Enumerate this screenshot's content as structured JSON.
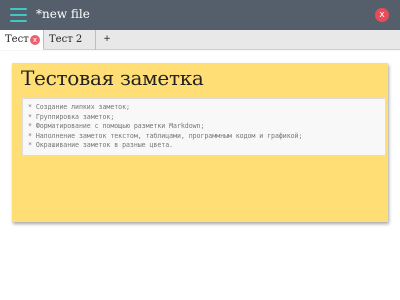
{
  "window": {
    "title": "*new file",
    "close_label": "x"
  },
  "tabs": [
    {
      "label": "Тест",
      "active": true,
      "close_label": "x"
    },
    {
      "label": "Тест 2",
      "active": false
    }
  ],
  "tab_add_label": "+",
  "note": {
    "title": "Тестовая заметка",
    "color": "#ffde75",
    "lines": [
      "* Создание липких заметок;",
      "* Группировка заметок;",
      "* Форматирование с помощью разметки Markdown;",
      "* Наполнение заметок текстом, таблицами, программным кодом и графикой;",
      "* Окрашивание заметок в разные цвета."
    ]
  },
  "colors": {
    "titlebar": "#555f6b",
    "accent": "#3fc7c7",
    "close": "#e84c5a"
  },
  "icons": {
    "menu": "hamburger-menu-icon",
    "close": "close-icon",
    "add": "plus-icon"
  }
}
